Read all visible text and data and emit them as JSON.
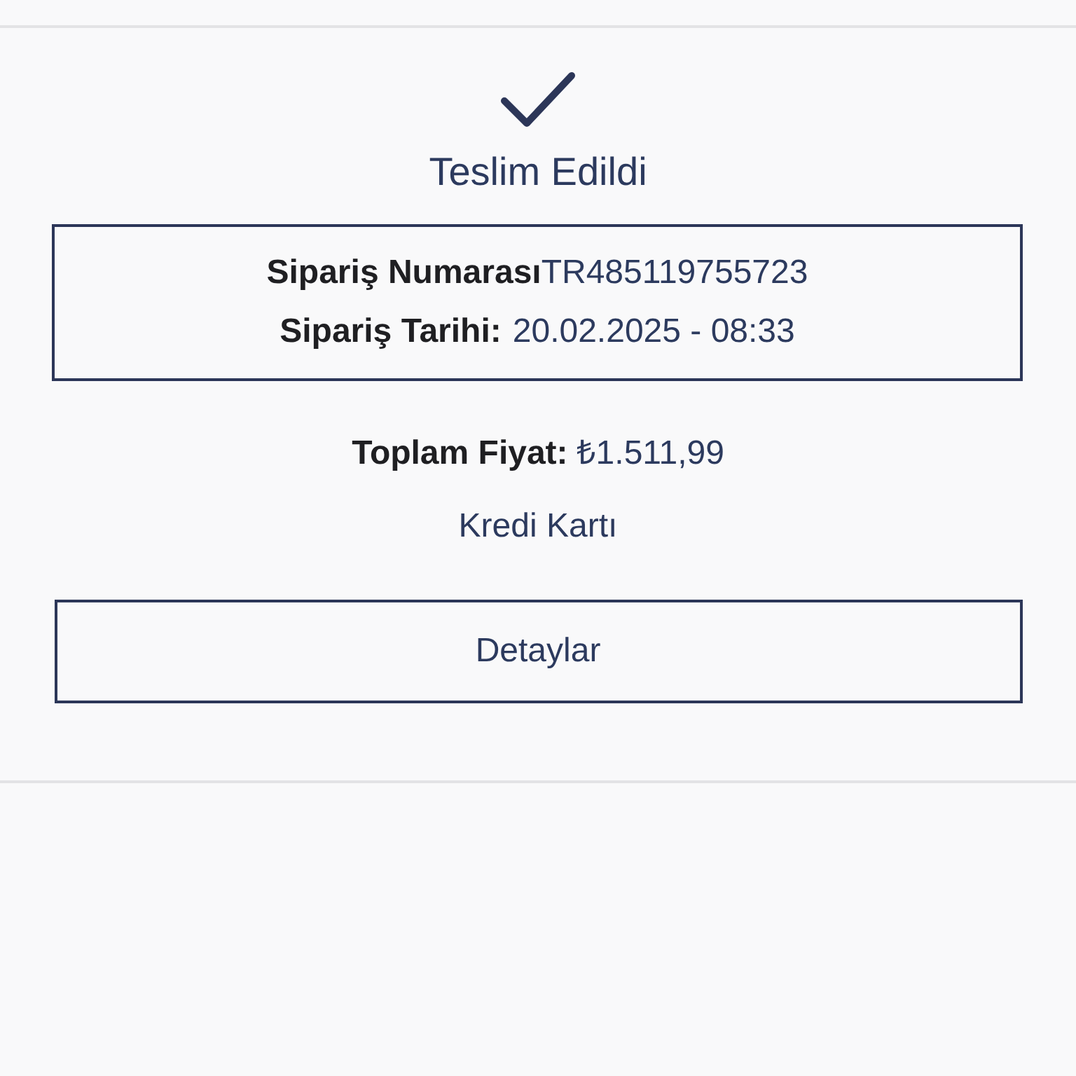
{
  "status": {
    "label": "Teslim Edildi",
    "delivered": true
  },
  "order_info": [
    {
      "label": "Sipariş Numarası",
      "value": "TR485119755723"
    },
    {
      "label": "Sipariş Tarihi:",
      "value": "20.02.2025 - 08:33"
    }
  ],
  "total": {
    "label": "Toplam Fiyat:",
    "value": "₺1.511,99"
  },
  "payment_method": "Kredi Kartı",
  "details_button": "Detaylar"
}
